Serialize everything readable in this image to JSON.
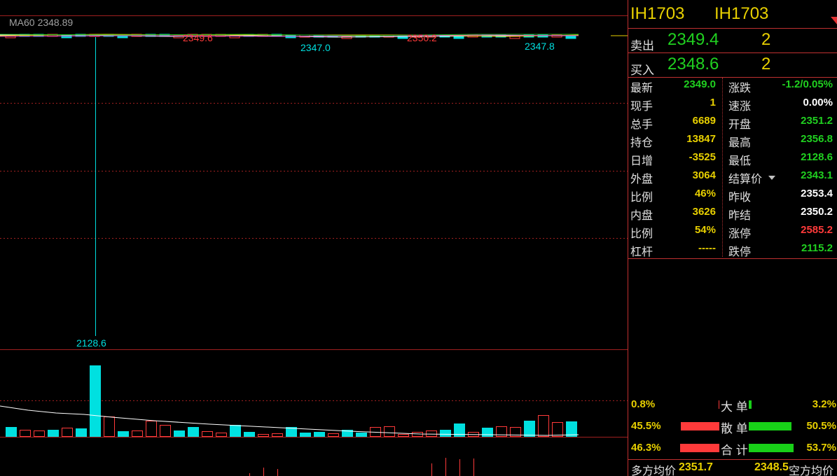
{
  "contract": {
    "code_left": "IH1703",
    "code_right": "IH1703"
  },
  "chart": {
    "ma_label": "MA60",
    "ma_value": "2348.89",
    "price_labels": [
      "2349.6",
      "2347.0",
      "2350.2",
      "2347.8",
      "2128.6"
    ],
    "colors": {
      "up": "#ff3a3a",
      "down": "#00e0e0",
      "grid": "#a02020",
      "ma": "#ffffff"
    }
  },
  "quote": {
    "sell_label": "卖出",
    "sell_price": "2349.4",
    "sell_qty": "2",
    "buy_label": "买入",
    "buy_price": "2348.6",
    "buy_qty": "2"
  },
  "stats_left": [
    {
      "k": "最新",
      "v": "2349.0",
      "color": "#20d020"
    },
    {
      "k": "现手",
      "v": "1",
      "color": "#e8d000"
    },
    {
      "k": "总手",
      "v": "6689",
      "color": "#e8d000"
    },
    {
      "k": "持仓",
      "v": "13847",
      "color": "#e8d000"
    },
    {
      "k": "日增",
      "v": "-3525",
      "color": "#e8d000"
    },
    {
      "k": "外盘",
      "v": "3064",
      "color": "#e8d000"
    },
    {
      "k": "比例",
      "v": "46%",
      "color": "#e8d000"
    },
    {
      "k": "内盘",
      "v": "3626",
      "color": "#e8d000"
    },
    {
      "k": "比例",
      "v": "54%",
      "color": "#e8d000"
    },
    {
      "k": "杠杆",
      "v": "-----",
      "color": "#e8d000"
    }
  ],
  "stats_right": [
    {
      "k": "涨跌",
      "v": "-1.2/0.05%",
      "color": "#20d020"
    },
    {
      "k": "速涨",
      "v": "0.00%",
      "color": "#ffffff"
    },
    {
      "k": "开盘",
      "v": "2351.2",
      "color": "#20d020"
    },
    {
      "k": "最高",
      "v": "2356.8",
      "color": "#20d020"
    },
    {
      "k": "最低",
      "v": "2128.6",
      "color": "#20d020"
    },
    {
      "k": "结算价",
      "v": "2343.1",
      "color": "#20d020"
    },
    {
      "k": "昨收",
      "v": "2353.4",
      "color": "#ffffff"
    },
    {
      "k": "昨结",
      "v": "2350.2",
      "color": "#ffffff"
    },
    {
      "k": "涨停",
      "v": "2585.2",
      "color": "#ff3a3a"
    },
    {
      "k": "跌停",
      "v": "2115.2",
      "color": "#20d020"
    }
  ],
  "flow": [
    {
      "name": "大 单",
      "left": "0.8%",
      "right": "3.2%",
      "left_frac": 0.008,
      "right_frac": 0.032
    },
    {
      "name": "散 单",
      "left": "45.5%",
      "right": "50.5%",
      "left_frac": 0.455,
      "right_frac": 0.505
    },
    {
      "name": "合 计",
      "left": "46.3%",
      "right": "53.7%",
      "left_frac": 0.463,
      "right_frac": 0.537
    }
  ],
  "avg": {
    "long_label": "多方均价",
    "long_value": "2351.7",
    "short_value": "2348.5",
    "short_label": "空方均价"
  }
}
